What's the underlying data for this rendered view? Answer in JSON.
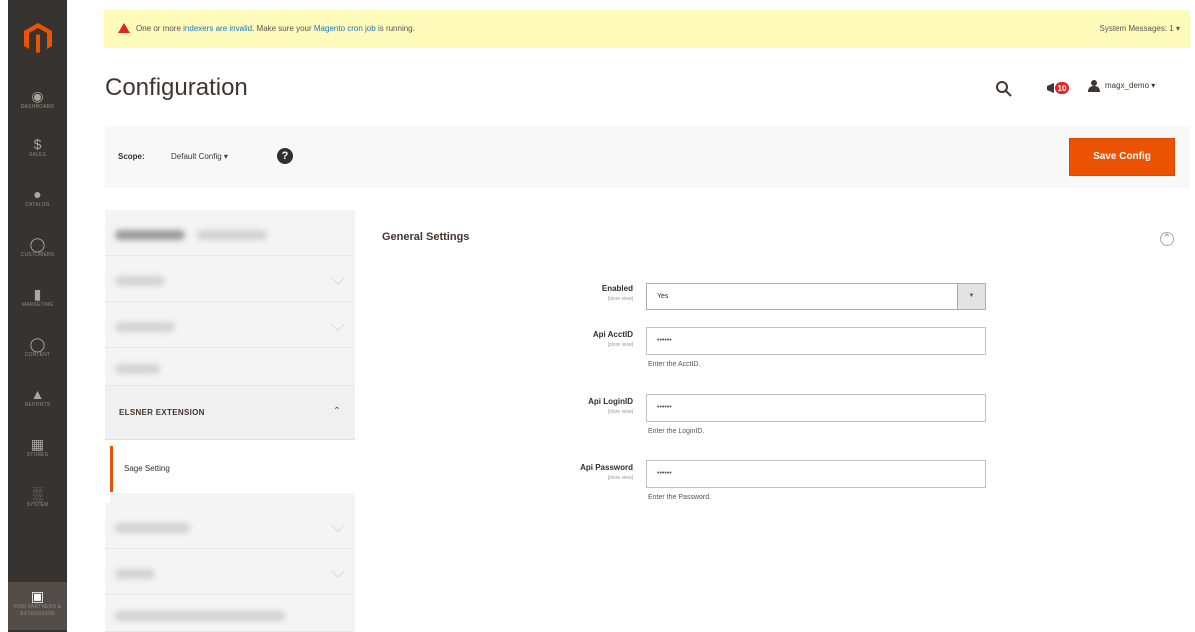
{
  "nav": {
    "items": [
      {
        "label": "Dashboard",
        "icon": "dashboard-icon"
      },
      {
        "label": "Sales",
        "icon": "dollar-icon"
      },
      {
        "label": "Catalog",
        "icon": "box-icon"
      },
      {
        "label": "Customers",
        "icon": "person-icon"
      },
      {
        "label": "Marketing",
        "icon": "megaphone-icon"
      },
      {
        "label": "Content",
        "icon": "layout-icon"
      },
      {
        "label": "Reports",
        "icon": "bar-chart-icon"
      },
      {
        "label": "Stores",
        "icon": "store-icon"
      },
      {
        "label": "System",
        "icon": "gear-icon"
      },
      {
        "label": "Find Partners & Extensions",
        "icon": "puzzle-icon"
      }
    ]
  },
  "system_message": {
    "text_before": "One or more ",
    "link1": "indexers are invalid",
    "text_middle": ". Make sure your ",
    "link2": "Magento cron job",
    "text_after": " is running.",
    "right": "System Messages: 1"
  },
  "header": {
    "title": "Configuration",
    "notifications_count": "10",
    "username": "magx_demo"
  },
  "scope": {
    "label": "Scope:",
    "value": "Default Config",
    "help": "?"
  },
  "buttons": {
    "save": "Save Config"
  },
  "tabs": {
    "section": "ELSNER EXTENSION",
    "sub_item": "Sage Setting"
  },
  "general": {
    "title": "General Settings",
    "enabled": {
      "label": "Enabled",
      "scope": "[store view]",
      "value": "Yes"
    },
    "api_acctid": {
      "label": "Api AcctID",
      "scope": "[store view]",
      "value": "••••••",
      "note": "Enter the AcctID."
    },
    "api_loginid": {
      "label": "Api LoginID",
      "scope": "[store view]",
      "value": "••••••",
      "note": "Enter the LoginID."
    },
    "api_password": {
      "label": "Api Password",
      "scope": "[store view]",
      "value": "••••••",
      "note": "Enter the Password."
    }
  },
  "colors": {
    "accent": "#eb5202",
    "nav_bg": "#373330",
    "message_bg": "#fffbbb"
  }
}
